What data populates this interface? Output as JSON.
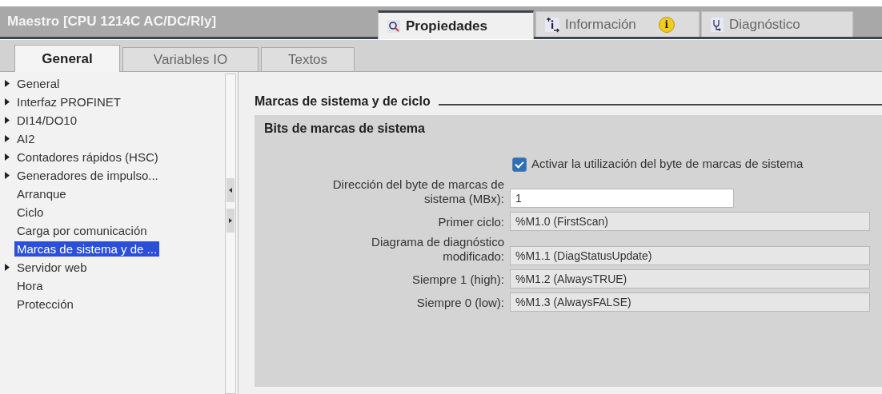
{
  "window": {
    "title": "Maestro [CPU 1214C AC/DC/Rly]"
  },
  "inspector_tabs": [
    {
      "label": "Propiedades",
      "selected": true
    },
    {
      "label": "Información",
      "selected": false,
      "badge": "i"
    },
    {
      "label": "Diagnóstico",
      "selected": false
    }
  ],
  "tabs": [
    {
      "label": "General",
      "selected": true
    },
    {
      "label": "Variables IO",
      "selected": false
    },
    {
      "label": "Textos",
      "selected": false
    }
  ],
  "sidebar": {
    "items": [
      {
        "label": "General",
        "kind": "group",
        "selected": false
      },
      {
        "label": "Interfaz PROFINET",
        "kind": "group",
        "selected": false
      },
      {
        "label": "DI14/DO10",
        "kind": "group",
        "selected": false
      },
      {
        "label": "AI2",
        "kind": "group",
        "selected": false
      },
      {
        "label": "Contadores rápidos (HSC)",
        "kind": "group",
        "selected": false
      },
      {
        "label": "Generadores de impulso...",
        "kind": "group",
        "selected": false
      },
      {
        "label": "Arranque",
        "kind": "leaf",
        "selected": false
      },
      {
        "label": "Ciclo",
        "kind": "leaf",
        "selected": false
      },
      {
        "label": "Carga por comunicación",
        "kind": "leaf",
        "selected": false
      },
      {
        "label": "Marcas de sistema y de ...",
        "kind": "leaf",
        "selected": true
      },
      {
        "label": "Servidor web",
        "kind": "group",
        "selected": false
      },
      {
        "label": "Hora",
        "kind": "leaf",
        "selected": false
      },
      {
        "label": "Protección",
        "kind": "leaf",
        "selected": false
      }
    ]
  },
  "section": {
    "title": "Marcas de sistema y de ciclo",
    "group": {
      "title": "Bits de marcas de sistema",
      "checkbox": {
        "label": "Activar la utilización del byte de marcas de sistema",
        "checked": true
      },
      "fields": [
        {
          "label": "Dirección del byte de marcas de sistema (MBx):",
          "value": "1",
          "kind": "input"
        },
        {
          "label": "Primer ciclo:",
          "value": "%M1.0 (FirstScan)",
          "kind": "readonly"
        },
        {
          "label": "Diagrama de diagnóstico modificado:",
          "value": "%M1.1 (DiagStatusUpdate)",
          "kind": "readonly"
        },
        {
          "label": "Siempre 1 (high):",
          "value": "%M1.2 (AlwaysTRUE)",
          "kind": "readonly"
        },
        {
          "label": "Siempre 0 (low):",
          "value": "%M1.3 (AlwaysFALSE)",
          "kind": "readonly"
        }
      ]
    }
  }
}
